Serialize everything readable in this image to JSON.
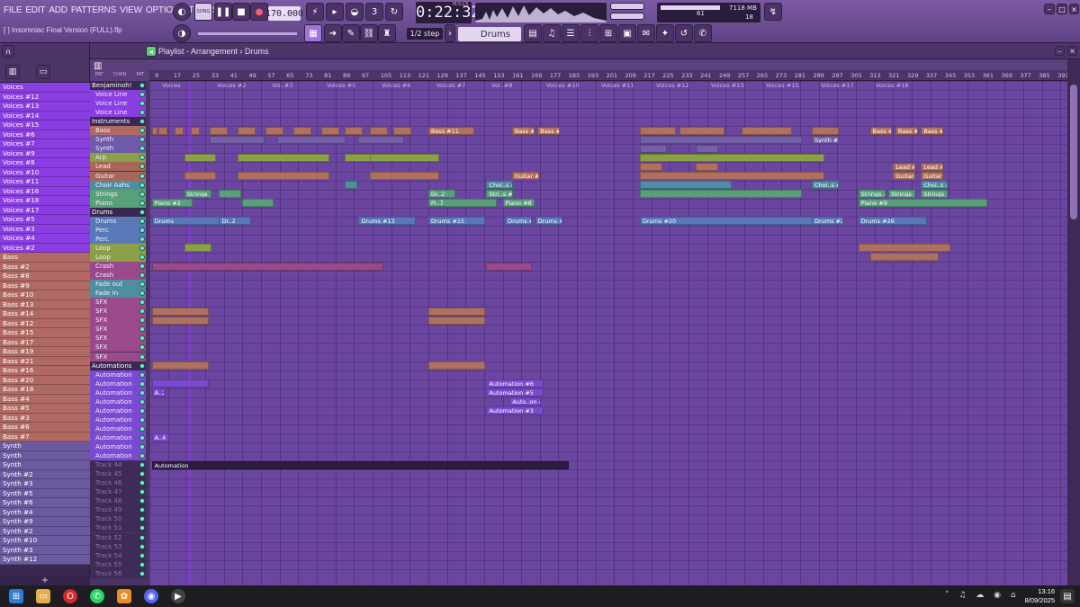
{
  "window": {
    "project_file": "[ ] Insomniac Final Version (FULL).flp"
  },
  "menu": [
    "FILE",
    "EDIT",
    "ADD",
    "PATTERNS",
    "VIEW",
    "OPTIONS",
    "TOOLS",
    "HELP"
  ],
  "transport": {
    "pat_song": "SONG",
    "tempo": "170.000",
    "time": "0:22:32",
    "time_unit": "M:S:CS"
  },
  "monitor": {
    "cpu_value": "61",
    "memory": "7118 MB",
    "polyphony": "18"
  },
  "toolbar2": {
    "snap": "1/2 step",
    "pattern": "Drums"
  },
  "playlist": {
    "title": "Playlist - Arrangement › Drums",
    "mode_labels": [
      "PAT",
      "CHAN",
      "PAT"
    ]
  },
  "ruler": [
    "9",
    "17",
    "25",
    "33",
    "41",
    "49",
    "57",
    "65",
    "73",
    "81",
    "89",
    "97",
    "105",
    "113",
    "121",
    "129",
    "137",
    "145",
    "153",
    "161",
    "169",
    "177",
    "185",
    "193",
    "201",
    "209",
    "217",
    "225",
    "233",
    "241",
    "249",
    "257",
    "265",
    "273",
    "281",
    "289",
    "297",
    "305",
    "313",
    "321",
    "329",
    "337",
    "345",
    "353",
    "361",
    "369",
    "377",
    "385",
    "393"
  ],
  "browser_items": [
    {
      "label": "Voices",
      "kind": "voice"
    },
    {
      "label": "Voices #12",
      "kind": "voice"
    },
    {
      "label": "Voices #13",
      "kind": "voice"
    },
    {
      "label": "Voices #14",
      "kind": "voice"
    },
    {
      "label": "Voices #15",
      "kind": "voice"
    },
    {
      "label": "Voices #6",
      "kind": "voice"
    },
    {
      "label": "Voices #7",
      "kind": "voice"
    },
    {
      "label": "Voices #9",
      "kind": "voice"
    },
    {
      "label": "Voices #8",
      "kind": "voice"
    },
    {
      "label": "Voices #10",
      "kind": "voice"
    },
    {
      "label": "Voices #11",
      "kind": "voice"
    },
    {
      "label": "Voices #16",
      "kind": "voice"
    },
    {
      "label": "Voices #18",
      "kind": "voice"
    },
    {
      "label": "Voices #17",
      "kind": "voice"
    },
    {
      "label": "Voices #5",
      "kind": "voice"
    },
    {
      "label": "Voices #3",
      "kind": "voice"
    },
    {
      "label": "Voices #4",
      "kind": "voice"
    },
    {
      "label": "Voices #2",
      "kind": "voice"
    },
    {
      "label": "Bass",
      "kind": "bass"
    },
    {
      "label": "Bass #2",
      "kind": "bass"
    },
    {
      "label": "Bass #8",
      "kind": "bass"
    },
    {
      "label": "Bass #9",
      "kind": "bass"
    },
    {
      "label": "Bass #10",
      "kind": "bass"
    },
    {
      "label": "Bass #13",
      "kind": "bass"
    },
    {
      "label": "Bass #14",
      "kind": "bass"
    },
    {
      "label": "Bass #12",
      "kind": "bass"
    },
    {
      "label": "Bass #15",
      "kind": "bass"
    },
    {
      "label": "Bass #17",
      "kind": "bass"
    },
    {
      "label": "Bass #19",
      "kind": "bass"
    },
    {
      "label": "Bass #21",
      "kind": "bass"
    },
    {
      "label": "Bass #16",
      "kind": "bass"
    },
    {
      "label": "Bass #20",
      "kind": "bass"
    },
    {
      "label": "Bass #18",
      "kind": "bass"
    },
    {
      "label": "Bass #4",
      "kind": "bass"
    },
    {
      "label": "Bass #5",
      "kind": "bass"
    },
    {
      "label": "Bass #3",
      "kind": "bass"
    },
    {
      "label": "Bass #6",
      "kind": "bass"
    },
    {
      "label": "Bass #7",
      "kind": "bass"
    },
    {
      "label": "Synth",
      "kind": "synth"
    },
    {
      "label": "Synth",
      "kind": "synth"
    },
    {
      "label": "Synth",
      "kind": "synth"
    },
    {
      "label": "Synth #2",
      "kind": "synth"
    },
    {
      "label": "Synth #3",
      "kind": "synth"
    },
    {
      "label": "Synth #5",
      "kind": "synth"
    },
    {
      "label": "Synth #6",
      "kind": "synth"
    },
    {
      "label": "Synth #4",
      "kind": "synth"
    },
    {
      "label": "Synth #9",
      "kind": "synth"
    },
    {
      "label": "Synth #2",
      "kind": "synth"
    },
    {
      "label": "Synth #10",
      "kind": "synth"
    },
    {
      "label": "Synth #3",
      "kind": "synth"
    },
    {
      "label": "Synth #12",
      "kind": "synth"
    }
  ],
  "tracks": [
    {
      "label": "Benjaminoh!",
      "group": true
    },
    {
      "label": "Voice Line"
    },
    {
      "label": "Voice Line"
    },
    {
      "label": "Voice Line"
    },
    {
      "label": "Instruments",
      "group": true
    },
    {
      "label": "Bass"
    },
    {
      "label": "Synth"
    },
    {
      "label": "Synth"
    },
    {
      "label": "Arp"
    },
    {
      "label": "Lead"
    },
    {
      "label": "Guitar"
    },
    {
      "label": "Choir Aahs"
    },
    {
      "label": "Strings"
    },
    {
      "label": "Piano"
    },
    {
      "label": "Drums",
      "group": true
    },
    {
      "label": "Drums"
    },
    {
      "label": "Perc"
    },
    {
      "label": "Perc"
    },
    {
      "label": "Loop"
    },
    {
      "label": "Loop"
    },
    {
      "label": "Crash"
    },
    {
      "label": "Crash"
    },
    {
      "label": "Fade out"
    },
    {
      "label": "Fade In"
    },
    {
      "label": "SFX"
    },
    {
      "label": "SFX"
    },
    {
      "label": "SFX"
    },
    {
      "label": "SFX"
    },
    {
      "label": "SFX"
    },
    {
      "label": "SFX"
    },
    {
      "label": "SFX"
    },
    {
      "label": "Automations",
      "group": true
    },
    {
      "label": "Automation"
    },
    {
      "label": "Automation"
    },
    {
      "label": "Automation"
    },
    {
      "label": "Automation"
    },
    {
      "label": "Automation"
    },
    {
      "label": "Automation"
    },
    {
      "label": "Automation"
    },
    {
      "label": "Automation"
    },
    {
      "label": "Automation"
    },
    {
      "label": "Automation"
    },
    {
      "label": "Track 44",
      "empty": true
    },
    {
      "label": "Track 45",
      "empty": true
    },
    {
      "label": "Track 46",
      "empty": true
    },
    {
      "label": "Track 47",
      "empty": true
    },
    {
      "label": "Track 48",
      "empty": true
    },
    {
      "label": "Track 49",
      "empty": true
    },
    {
      "label": "Track 50",
      "empty": true
    },
    {
      "label": "Track 51",
      "empty": true
    },
    {
      "label": "Track 52",
      "empty": true
    },
    {
      "label": "Track 53",
      "empty": true
    },
    {
      "label": "Track 54",
      "empty": true
    },
    {
      "label": "Track 55",
      "empty": true
    },
    {
      "label": "Track 56",
      "empty": true
    }
  ],
  "voice_headers": [
    "Voices",
    "Voices #2",
    "Voi..#3",
    "Voices #5",
    "Voices #6",
    "Voices #7",
    "Voi..#8",
    "Voices #10",
    "Voices #11",
    "Voices #12",
    "Voices #13",
    "Voices #15",
    "Voices #17",
    "Voices #18"
  ],
  "clips": [
    {
      "row": 5,
      "bar": 1,
      "len": 2,
      "label": "",
      "color": "#b07060"
    },
    {
      "row": 5,
      "bar": 4,
      "len": 4,
      "label": "",
      "color": "#b07060"
    },
    {
      "row": 5,
      "bar": 11,
      "len": 4,
      "label": "",
      "color": "#b07060"
    },
    {
      "row": 5,
      "bar": 18,
      "len": 4,
      "label": "",
      "color": "#b07060"
    },
    {
      "row": 5,
      "bar": 26,
      "len": 8,
      "label": "",
      "color": "#b07060"
    },
    {
      "row": 5,
      "bar": 38,
      "len": 8,
      "label": "",
      "color": "#b07060"
    },
    {
      "row": 5,
      "bar": 50,
      "len": 8,
      "label": "",
      "color": "#b07060"
    },
    {
      "row": 5,
      "bar": 62,
      "len": 8,
      "label": "",
      "color": "#b07060"
    },
    {
      "row": 5,
      "bar": 74,
      "len": 8,
      "label": "",
      "color": "#b07060"
    },
    {
      "row": 5,
      "bar": 84,
      "len": 8,
      "label": "",
      "color": "#b07060"
    },
    {
      "row": 5,
      "bar": 95,
      "len": 8,
      "label": "",
      "color": "#b07060"
    },
    {
      "row": 5,
      "bar": 105,
      "len": 8,
      "label": "",
      "color": "#b07060"
    },
    {
      "row": 5,
      "bar": 120,
      "len": 20,
      "label": "Bass #11",
      "color": "#b07060"
    },
    {
      "row": 5,
      "bar": 156,
      "len": 10,
      "label": "Bass #12",
      "color": "#b07060"
    },
    {
      "row": 5,
      "bar": 167,
      "len": 10,
      "label": "Bass #12",
      "color": "#b07060"
    },
    {
      "row": 5,
      "bar": 211,
      "len": 16,
      "label": "",
      "color": "#b07060"
    },
    {
      "row": 5,
      "bar": 228,
      "len": 20,
      "label": "",
      "color": "#b07060"
    },
    {
      "row": 5,
      "bar": 255,
      "len": 22,
      "label": "",
      "color": "#b07060"
    },
    {
      "row": 5,
      "bar": 285,
      "len": 12,
      "label": "",
      "color": "#b07060"
    },
    {
      "row": 5,
      "bar": 310,
      "len": 10,
      "label": "Bass #20",
      "color": "#b07060"
    },
    {
      "row": 5,
      "bar": 321,
      "len": 10,
      "label": "Bass #21",
      "color": "#b07060"
    },
    {
      "row": 5,
      "bar": 332,
      "len": 10,
      "label": "Bass #21",
      "color": "#b07060"
    },
    {
      "row": 6,
      "bar": 26,
      "len": 24,
      "label": "",
      "color": "#7560a8"
    },
    {
      "row": 6,
      "bar": 55,
      "len": 30,
      "label": "",
      "color": "#7560a8"
    },
    {
      "row": 6,
      "bar": 90,
      "len": 20,
      "label": "",
      "color": "#7560a8"
    },
    {
      "row": 6,
      "bar": 211,
      "len": 70,
      "label": "",
      "color": "#7560a8"
    },
    {
      "row": 6,
      "bar": 285,
      "len": 12,
      "label": "Synth #13",
      "color": "#7560a8"
    },
    {
      "row": 7,
      "bar": 211,
      "len": 12,
      "label": "",
      "color": "#7560a8"
    },
    {
      "row": 7,
      "bar": 235,
      "len": 10,
      "label": "",
      "color": "#7560a8"
    },
    {
      "row": 8,
      "bar": 15,
      "len": 14,
      "label": "",
      "color": "#8aa048"
    },
    {
      "row": 8,
      "bar": 38,
      "len": 40,
      "label": "",
      "color": "#8aa048"
    },
    {
      "row": 8,
      "bar": 84,
      "len": 14,
      "label": "",
      "color": "#8aa048"
    },
    {
      "row": 8,
      "bar": 95,
      "len": 30,
      "label": "",
      "color": "#8aa048"
    },
    {
      "row": 8,
      "bar": 211,
      "len": 80,
      "label": "",
      "color": "#8aa048"
    },
    {
      "row": 9,
      "bar": 211,
      "len": 10,
      "label": "",
      "color": "#b07060"
    },
    {
      "row": 9,
      "bar": 235,
      "len": 10,
      "label": "",
      "color": "#b07060"
    },
    {
      "row": 9,
      "bar": 320,
      "len": 10,
      "label": "Lead #5",
      "color": "#b07060"
    },
    {
      "row": 9,
      "bar": 332,
      "len": 10,
      "label": "Lead #6",
      "color": "#b07060"
    },
    {
      "row": 10,
      "bar": 15,
      "len": 14,
      "label": "",
      "color": "#b07060"
    },
    {
      "row": 10,
      "bar": 38,
      "len": 40,
      "label": "",
      "color": "#b07060"
    },
    {
      "row": 10,
      "bar": 95,
      "len": 30,
      "label": "",
      "color": "#b07060"
    },
    {
      "row": 10,
      "bar": 156,
      "len": 12,
      "label": "Guitar #12",
      "color": "#b07060"
    },
    {
      "row": 10,
      "bar": 211,
      "len": 80,
      "label": "",
      "color": "#b07060"
    },
    {
      "row": 10,
      "bar": 320,
      "len": 10,
      "label": "Guitar #22",
      "color": "#b07060"
    },
    {
      "row": 10,
      "bar": 332,
      "len": 10,
      "label": "Guitar #22",
      "color": "#b07060"
    },
    {
      "row": 11,
      "bar": 84,
      "len": 6,
      "label": "",
      "color": "#4f8ea0"
    },
    {
      "row": 11,
      "bar": 145,
      "len": 12,
      "label": "Choi..s #4",
      "color": "#4f8ea0"
    },
    {
      "row": 11,
      "bar": 211,
      "len": 40,
      "label": "",
      "color": "#4f8ea0"
    },
    {
      "row": 11,
      "bar": 285,
      "len": 12,
      "label": "Choi..s #10",
      "color": "#4f8ea0"
    },
    {
      "row": 11,
      "bar": 332,
      "len": 12,
      "label": "Choi..s #11",
      "color": "#4f8ea0"
    },
    {
      "row": 12,
      "bar": 15,
      "len": 12,
      "label": "Strings",
      "color": "#58a07a"
    },
    {
      "row": 12,
      "bar": 30,
      "len": 10,
      "label": "",
      "color": "#58a07a"
    },
    {
      "row": 12,
      "bar": 120,
      "len": 12,
      "label": "Dr..2",
      "color": "#58a07a"
    },
    {
      "row": 12,
      "bar": 145,
      "len": 12,
      "label": "Stri..s #4",
      "color": "#58a07a"
    },
    {
      "row": 12,
      "bar": 211,
      "len": 70,
      "label": "",
      "color": "#58a07a"
    },
    {
      "row": 12,
      "bar": 305,
      "len": 12,
      "label": "Strings #5",
      "color": "#58a07a"
    },
    {
      "row": 12,
      "bar": 318,
      "len": 12,
      "label": "Strings #6",
      "color": "#58a07a"
    },
    {
      "row": 12,
      "bar": 332,
      "len": 12,
      "label": "Strings #6",
      "color": "#58a07a"
    },
    {
      "row": 13,
      "bar": 1,
      "len": 18,
      "label": "Piano #2",
      "color": "#58a07a"
    },
    {
      "row": 13,
      "bar": 40,
      "len": 14,
      "label": "",
      "color": "#58a07a"
    },
    {
      "row": 13,
      "bar": 120,
      "len": 30,
      "label": "Pi..7",
      "color": "#58a07a"
    },
    {
      "row": 13,
      "bar": 152,
      "len": 14,
      "label": "Piano #8",
      "color": "#58a07a"
    },
    {
      "row": 13,
      "bar": 305,
      "len": 56,
      "label": "Piano #9",
      "color": "#58a07a"
    },
    {
      "row": 15,
      "bar": 1,
      "len": 30,
      "label": "Drums",
      "color": "#5878b8"
    },
    {
      "row": 15,
      "bar": 30,
      "len": 14,
      "label": "Dr..2",
      "color": "#5878b8"
    },
    {
      "row": 15,
      "bar": 90,
      "len": 25,
      "label": "Drums #13",
      "color": "#5878b8"
    },
    {
      "row": 15,
      "bar": 120,
      "len": 25,
      "label": "Drums #15",
      "color": "#5878b8"
    },
    {
      "row": 15,
      "bar": 153,
      "len": 12,
      "label": "Drums #16",
      "color": "#5878b8"
    },
    {
      "row": 15,
      "bar": 166,
      "len": 12,
      "label": "Drums #17",
      "color": "#5878b8"
    },
    {
      "row": 15,
      "bar": 211,
      "len": 80,
      "label": "Drums #20",
      "color": "#5878b8"
    },
    {
      "row": 15,
      "bar": 285,
      "len": 14,
      "label": "Drums #24",
      "color": "#5878b8"
    },
    {
      "row": 15,
      "bar": 305,
      "len": 30,
      "label": "Drums #26",
      "color": "#5878b8"
    },
    {
      "row": 18,
      "bar": 15,
      "len": 12,
      "label": "",
      "color": "#8aa048"
    },
    {
      "row": 18,
      "bar": 305,
      "len": 40,
      "label": "",
      "color": "#b07060"
    },
    {
      "row": 19,
      "bar": 310,
      "len": 30,
      "label": "",
      "color": "#b07060"
    },
    {
      "row": 20,
      "bar": 1,
      "len": 100,
      "label": "",
      "color": "#9a4a8a"
    },
    {
      "row": 20,
      "bar": 145,
      "len": 20,
      "label": "",
      "color": "#9a4a8a"
    },
    {
      "row": 25,
      "bar": 1,
      "len": 25,
      "label": "",
      "color": "#b07060"
    },
    {
      "row": 25,
      "bar": 120,
      "len": 25,
      "label": "",
      "color": "#b07060"
    },
    {
      "row": 26,
      "bar": 1,
      "len": 25,
      "label": "",
      "color": "#b07060"
    },
    {
      "row": 26,
      "bar": 120,
      "len": 25,
      "label": "",
      "color": "#b07060"
    },
    {
      "row": 31,
      "bar": 1,
      "len": 25,
      "label": "",
      "color": "#b07060"
    },
    {
      "row": 31,
      "bar": 120,
      "len": 25,
      "label": "",
      "color": "#b07060"
    },
    {
      "row": 33,
      "bar": 1,
      "len": 25,
      "label": "",
      "color": "#7a4bd0"
    },
    {
      "row": 33,
      "bar": 145,
      "len": 25,
      "label": "Automation #6",
      "color": "#7a4bd0"
    },
    {
      "row": 34,
      "bar": 1,
      "len": 6,
      "label": "A..2",
      "color": "#7a4bd0"
    },
    {
      "row": 34,
      "bar": 145,
      "len": 25,
      "label": "Automation #5",
      "color": "#7a4bd0"
    },
    {
      "row": 35,
      "bar": 155,
      "len": 14,
      "label": "Auto..on #5",
      "color": "#7a4bd0"
    },
    {
      "row": 36,
      "bar": 145,
      "len": 25,
      "label": "Automation #3",
      "color": "#7a4bd0"
    },
    {
      "row": 39,
      "bar": 1,
      "len": 8,
      "label": "A..4",
      "color": "#7a4bd0"
    },
    {
      "row": 42,
      "bar": 1,
      "len": 180,
      "label": "Automation",
      "color": "#2c1c42"
    }
  ],
  "taskbar": {
    "time": "13:16",
    "date": "8/09/2025"
  }
}
